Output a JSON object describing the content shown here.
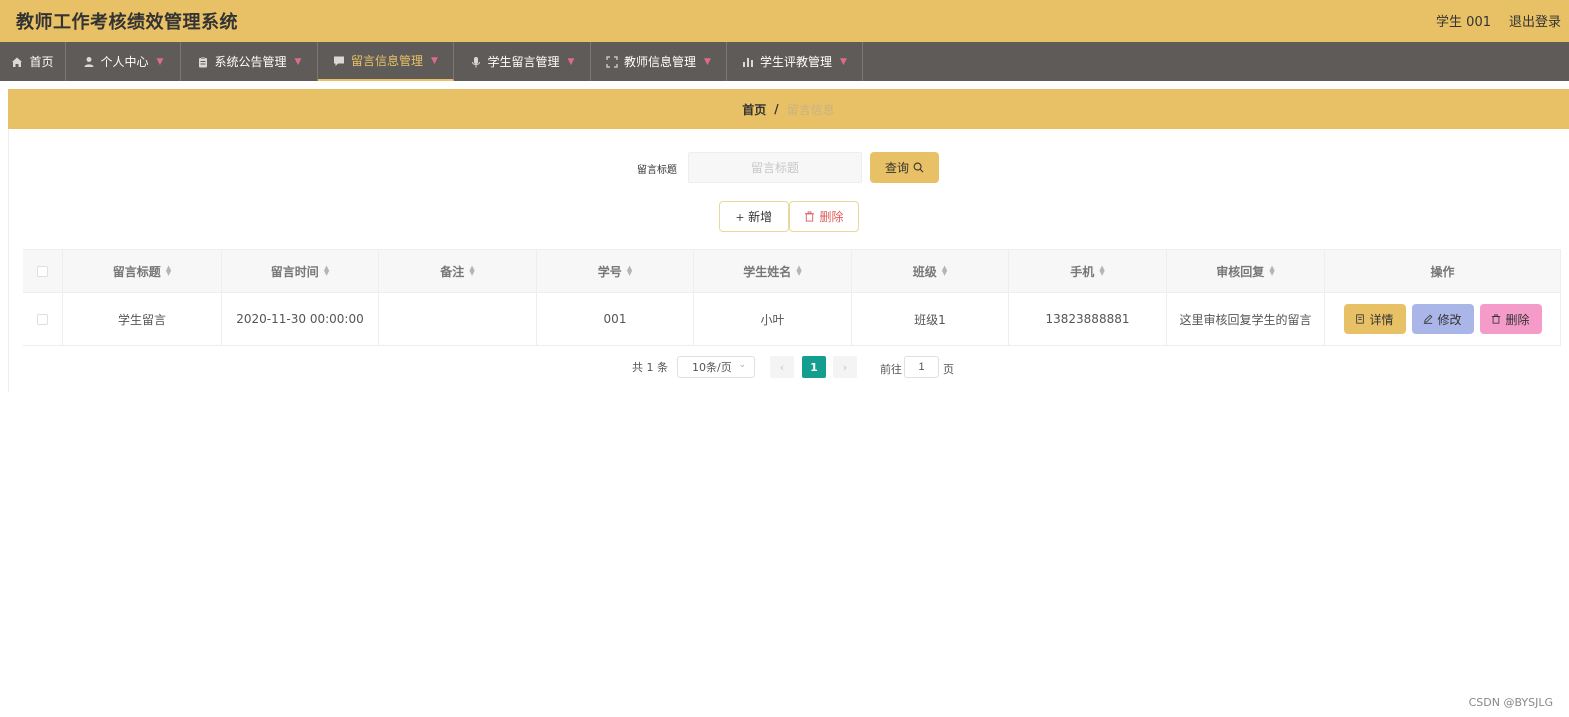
{
  "header": {
    "title": "教师工作考核绩效管理系统",
    "user": "学生 001",
    "logout": "退出登录"
  },
  "nav": {
    "items": [
      {
        "label": "首页",
        "icon": "home-icon"
      },
      {
        "label": "个人中心",
        "icon": "user-icon"
      },
      {
        "label": "系统公告管理",
        "icon": "clipboard-icon"
      },
      {
        "label": "留言信息管理",
        "icon": "message-icon",
        "active": true
      },
      {
        "label": "学生留言管理",
        "icon": "microphone-icon"
      },
      {
        "label": "教师信息管理",
        "icon": "fullscreen-icon"
      },
      {
        "label": "学生评教管理",
        "icon": "bar-chart-icon"
      }
    ]
  },
  "breadcrumb": {
    "home": "首页",
    "separator": "/",
    "current": "留言信息"
  },
  "search": {
    "label": "留言标题",
    "placeholder": "留言标题",
    "value": "",
    "query_label": "查询"
  },
  "actions": {
    "add_label": "新增",
    "delete_label": "删除"
  },
  "table": {
    "columns": [
      "留言标题",
      "留言时间",
      "备注",
      "学号",
      "学生姓名",
      "班级",
      "手机",
      "审核回复",
      "操作"
    ],
    "rows": [
      {
        "cells": [
          "学生留言",
          "2020-11-30 00:00:00",
          "",
          "001",
          "小叶",
          "班级1",
          "13823888881",
          "这里审核回复学生的留言"
        ],
        "ops": {
          "detail": "详情",
          "edit": "修改",
          "delete": "删除"
        }
      }
    ]
  },
  "pagination": {
    "total": "共 1 条",
    "page_size": "10条/页",
    "current_page": "1",
    "goto_prefix": "前往",
    "goto_value": "1",
    "goto_suffix": "页"
  },
  "watermark": "CSDN @BYSJLG",
  "colors": {
    "accent": "#e8c167",
    "nav_bg": "#5e5b58",
    "page_active": "#139e8f",
    "edit_btn": "#aab6e8",
    "delete_btn": "#f59bc9",
    "danger_text": "#e05b5b"
  }
}
